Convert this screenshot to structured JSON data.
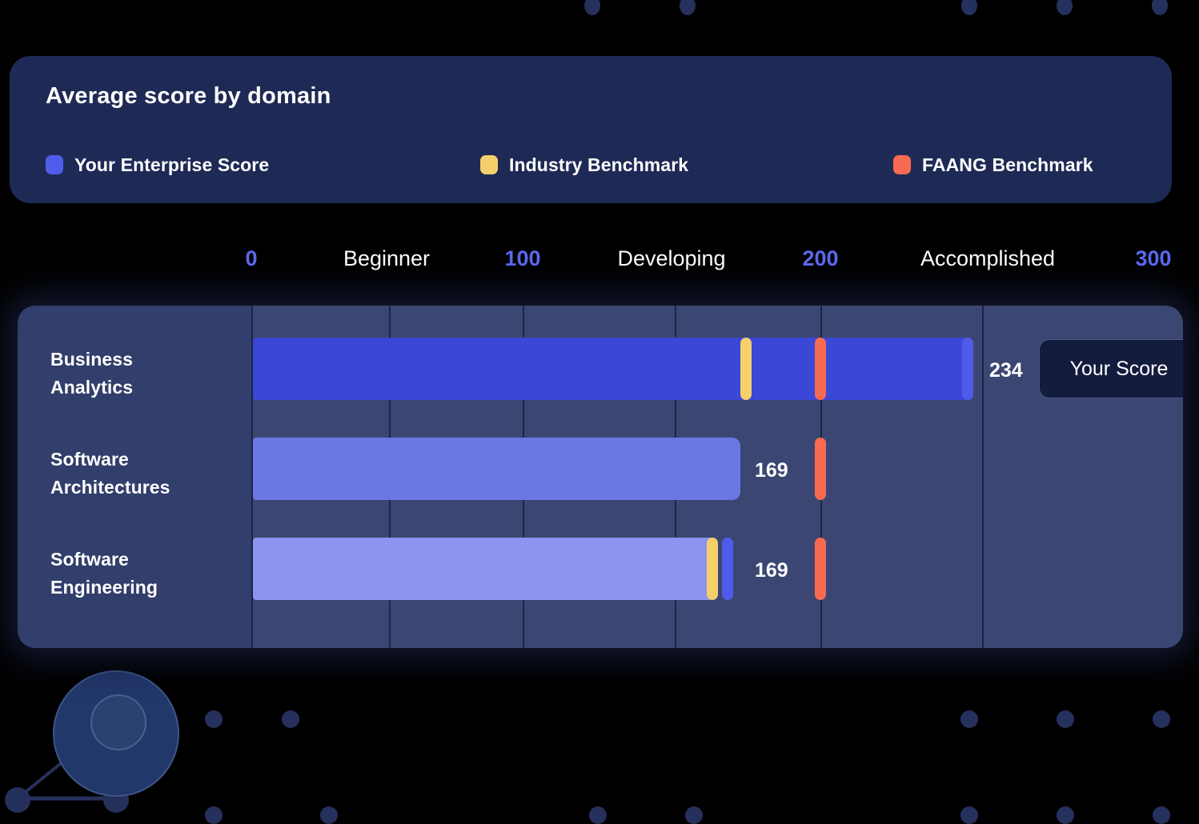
{
  "header": {
    "title": "Average score by domain"
  },
  "legend": [
    {
      "label": "Your Enterprise Score",
      "color": "#4f5bea",
      "name": "your-enterprise-score"
    },
    {
      "label": "Industry Benchmark",
      "color": "#f5d06a",
      "name": "industry-benchmark"
    },
    {
      "label": "FAANG Benchmark",
      "color": "#f86a52",
      "name": "faang-benchmark"
    }
  ],
  "axis": {
    "ticks": [
      {
        "label": "0",
        "value": 0
      },
      {
        "label": "100",
        "value": 100
      },
      {
        "label": "200",
        "value": 200
      },
      {
        "label": "300",
        "value": 300
      }
    ],
    "bands": [
      {
        "label": "Beginner",
        "center": 50
      },
      {
        "label": "Developing",
        "center": 150
      },
      {
        "label": "Accomplished",
        "center": 250
      }
    ]
  },
  "tooltip": {
    "label": "Your Score"
  },
  "chart_data": {
    "type": "bar",
    "title": "Average score by domain",
    "xlabel": "",
    "ylabel": "",
    "xlim": [
      0,
      300
    ],
    "orientation": "horizontal",
    "grid": true,
    "legend_position": "top",
    "categories": [
      "Business Analytics",
      "Software Architectures",
      "Software Engineering"
    ],
    "series": [
      {
        "name": "Your Enterprise Score",
        "color": "#4f5bea",
        "values": [
          234,
          169,
          169
        ]
      },
      {
        "name": "Industry Benchmark",
        "color": "#f5d06a",
        "values": [
          164,
          null,
          154
        ]
      },
      {
        "name": "FAANG Benchmark",
        "color": "#f86a52",
        "values": [
          190,
          190,
          190
        ]
      }
    ],
    "bar_colors": [
      "#3b47d6",
      "#6b77e2",
      "#8b94f0"
    ],
    "data_labels": [
      "234",
      "169",
      "169"
    ],
    "band_labels": [
      "Beginner",
      "Developing",
      "Accomplished"
    ],
    "tick_labels": [
      "0",
      "100",
      "200",
      "300"
    ]
  },
  "rows": [
    {
      "name": "business-analytics",
      "label_line1": "Business",
      "label_line2": "Analytics",
      "value": 234,
      "value_text": "234",
      "bar_color": "#3b47d6",
      "industry": 164,
      "faang": 190
    },
    {
      "name": "software-architectures",
      "label_line1": "Software",
      "label_line2": "Architectures",
      "value": 169,
      "value_text": "169",
      "bar_color": "#6b77e2",
      "industry": null,
      "faang": 190
    },
    {
      "name": "software-engineering",
      "label_line1": "Software",
      "label_line2": "Engineering",
      "value": 169,
      "value_text": "169",
      "bar_color": "#8b94f0",
      "industry": 154,
      "faang": 190
    }
  ],
  "colors": {
    "background": "#000000",
    "card": "#1e2a55",
    "panel": "#3b4772",
    "label_column": "#323e6b",
    "gridline": "#1b2448",
    "accent": "#5b6af0",
    "tooltip_bg": "#141c3d",
    "deco_dot": "#26305c"
  }
}
